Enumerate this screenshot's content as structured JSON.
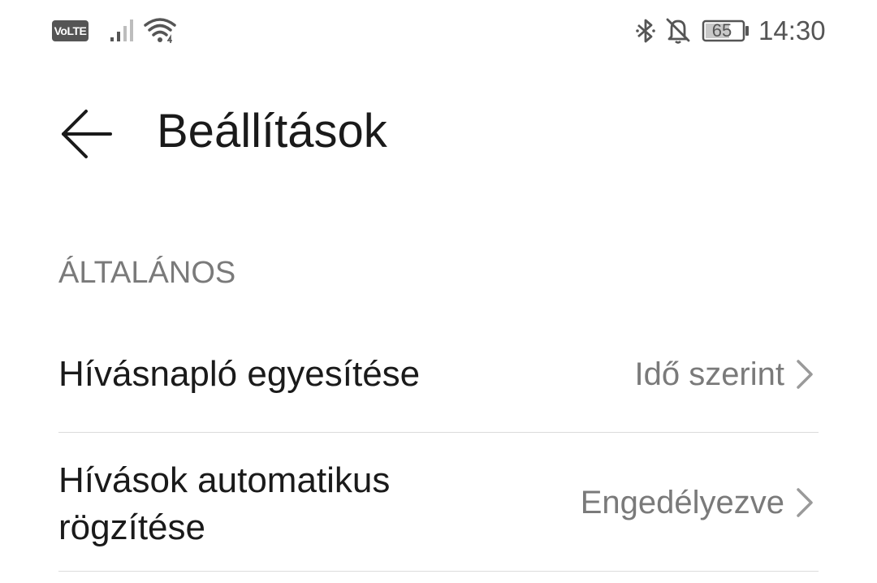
{
  "status_bar": {
    "volte": "VoLTE",
    "battery_level": "65",
    "time": "14:30",
    "icons": [
      "signal-icon",
      "wifi-icon",
      "bluetooth-icon",
      "bell-off-icon",
      "battery-icon"
    ]
  },
  "toolbar": {
    "back_icon": "arrow-left-icon",
    "title": "Beállítások"
  },
  "section": {
    "header": "ÁLTALÁNOS"
  },
  "settings": [
    {
      "title": "Hívásnapló egyesítése",
      "value": "Idő szerint"
    },
    {
      "title": "Hívások automatikus rögzítése",
      "value": "Engedélyezve"
    }
  ],
  "colors": {
    "primary_text": "#1a1a1a",
    "secondary_text": "#7a7a7a",
    "divider": "#dcdcdc",
    "status_icons": "#555555"
  }
}
